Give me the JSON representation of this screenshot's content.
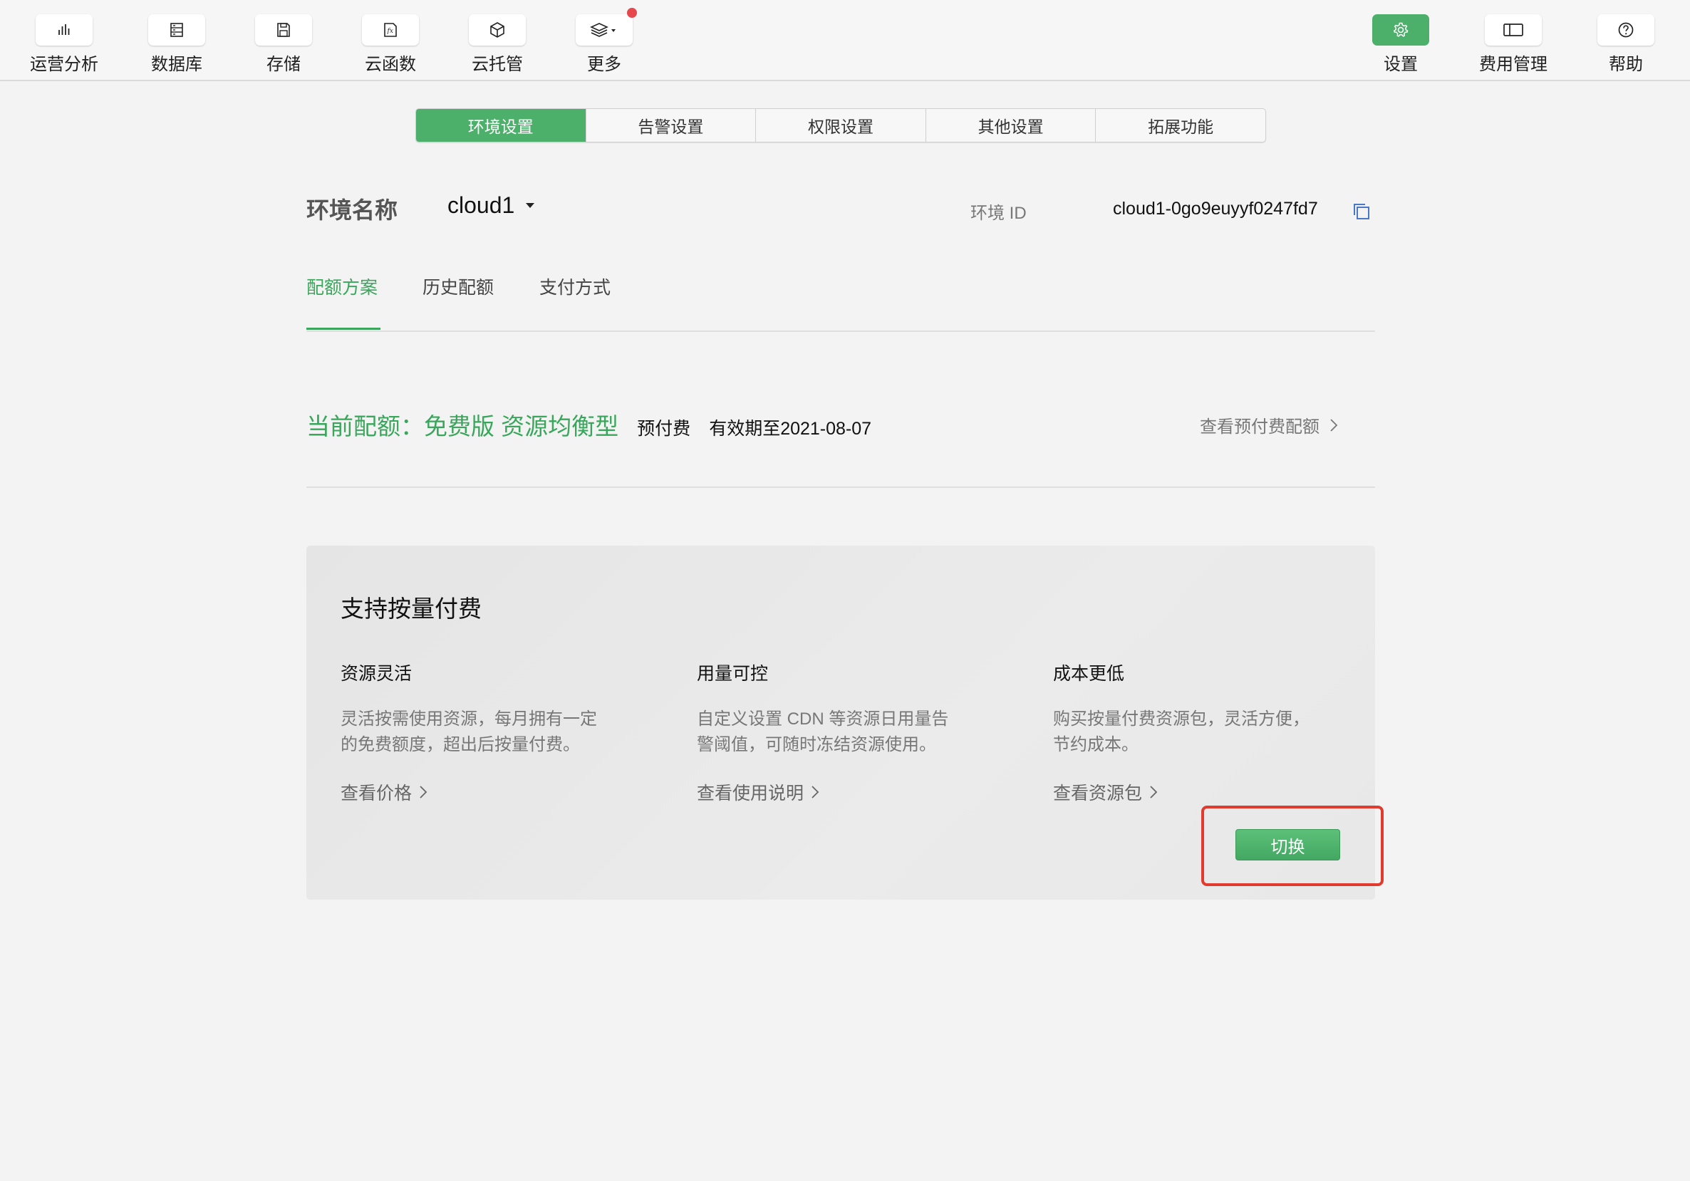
{
  "toolbar": {
    "left_items": [
      {
        "label": "运营分析",
        "icon": "bar-chart-icon"
      },
      {
        "label": "数据库",
        "icon": "database-icon"
      },
      {
        "label": "存储",
        "icon": "save-icon"
      },
      {
        "label": "云函数",
        "icon": "function-icon"
      },
      {
        "label": "云托管",
        "icon": "cube-icon"
      },
      {
        "label": "更多",
        "icon": "layers-icon",
        "has_badge": true
      }
    ],
    "right_items": [
      {
        "label": "设置",
        "icon": "gear-icon",
        "active": true
      },
      {
        "label": "费用管理",
        "icon": "billing-icon"
      },
      {
        "label": "帮助",
        "icon": "help-icon"
      }
    ]
  },
  "segment_tabs": [
    "环境设置",
    "告警设置",
    "权限设置",
    "其他设置",
    "拓展功能"
  ],
  "segment_active_index": 0,
  "env": {
    "name_label": "环境名称",
    "name_value": "cloud1",
    "id_label": "环境 ID",
    "id_value": "cloud1-0go9euyyf0247fd7"
  },
  "sub_tabs": [
    "配额方案",
    "历史配额",
    "支付方式"
  ],
  "sub_tab_active_index": 0,
  "quota": {
    "title": "当前配额：免费版 资源均衡型",
    "pay_type": "预付费",
    "valid_until": "有效期至2021-08-07",
    "link": "查看预付费配额"
  },
  "card": {
    "title": "支持按量付费",
    "features": [
      {
        "title": "资源灵活",
        "desc_lines": [
          "灵活按需使用资源，每月拥有一定",
          "的免费额度，超出后按量付费。"
        ],
        "link": "查看价格"
      },
      {
        "title": "用量可控",
        "desc_lines": [
          "自定义设置 CDN 等资源日用量告",
          "警阈值，可随时冻结资源使用。"
        ],
        "link": "查看使用说明"
      },
      {
        "title": "成本更低",
        "desc_lines": [
          "购买按量付费资源包，灵活方便，",
          "节约成本。"
        ],
        "link": "查看资源包"
      }
    ],
    "switch_button": "切换"
  },
  "colors": {
    "accent_green": "#4caf6a",
    "text_green": "#3aa65b",
    "highlight_red": "#e03b2e",
    "badge_red": "#e5484d"
  }
}
